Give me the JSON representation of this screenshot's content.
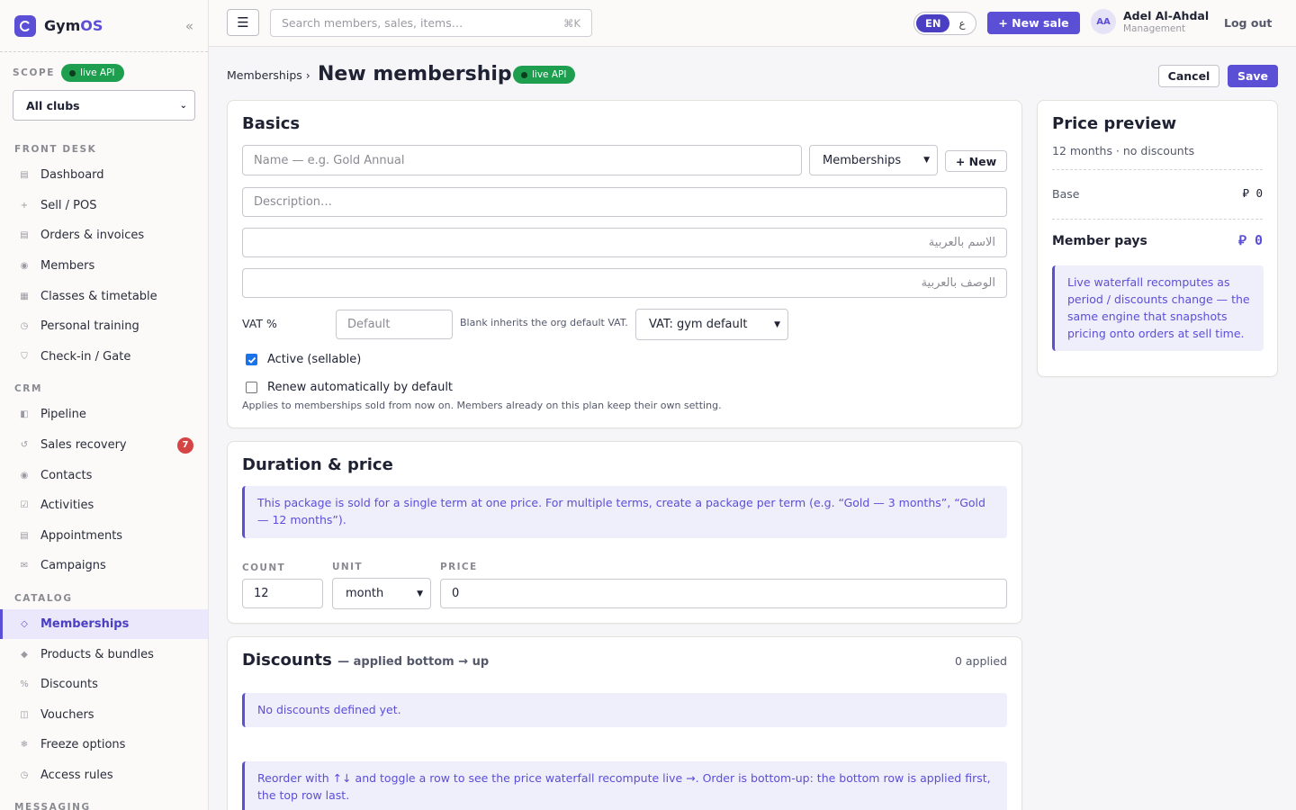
{
  "brand": {
    "name_prefix": "Gym",
    "name_suffix": "OS"
  },
  "sidebar": {
    "scope_label": "SCOPE",
    "live_label": "live API",
    "club_select": "All clubs",
    "groups": [
      {
        "label": "FRONT DESK",
        "items": [
          {
            "label": "Dashboard",
            "icon": "▤"
          },
          {
            "label": "Sell / POS",
            "icon": "+"
          },
          {
            "label": "Orders & invoices",
            "icon": "▤"
          },
          {
            "label": "Members",
            "icon": "◉"
          },
          {
            "label": "Classes & timetable",
            "icon": "▦"
          },
          {
            "label": "Personal training",
            "icon": "◷"
          },
          {
            "label": "Check-in / Gate",
            "icon": "⛉"
          }
        ]
      },
      {
        "label": "CRM",
        "items": [
          {
            "label": "Pipeline",
            "icon": "◧"
          },
          {
            "label": "Sales recovery",
            "icon": "↺",
            "badge": "7"
          },
          {
            "label": "Contacts",
            "icon": "◉"
          },
          {
            "label": "Activities",
            "icon": "☑"
          },
          {
            "label": "Appointments",
            "icon": "▤"
          },
          {
            "label": "Campaigns",
            "icon": "✉"
          }
        ]
      },
      {
        "label": "CATALOG",
        "items": [
          {
            "label": "Memberships",
            "icon": "◇",
            "active": true
          },
          {
            "label": "Products & bundles",
            "icon": "◆"
          },
          {
            "label": "Discounts",
            "icon": "%"
          },
          {
            "label": "Vouchers",
            "icon": "◫"
          },
          {
            "label": "Freeze options",
            "icon": "❄"
          },
          {
            "label": "Access rules",
            "icon": "◷"
          }
        ]
      },
      {
        "label": "MESSAGING",
        "items": []
      }
    ]
  },
  "topbar": {
    "menu_icon": "☰",
    "search_placeholder": "Search members, sales, items…",
    "search_shortcut": "⌘K",
    "lang_en": "EN",
    "lang_ar": "ع",
    "new_sale": "+ New sale",
    "user_initials": "AA",
    "user_name": "Adel Al-Ahdal",
    "user_role": "Management",
    "logout": "Log out"
  },
  "header": {
    "breadcrumb": "Memberships ›",
    "title": "New membership",
    "live_label": "live API",
    "cancel": "Cancel",
    "save": "Save"
  },
  "basics": {
    "title": "Basics",
    "name_placeholder": "Name — e.g. Gold Annual",
    "category": "Memberships",
    "new_btn": "+ New",
    "description_placeholder": "Description…",
    "name_ar_placeholder": "الاسم بالعربية",
    "description_ar_placeholder": "الوصف بالعربية",
    "vat_label": "VAT %",
    "vat_placeholder": "Default",
    "vat_hint": "Blank inherits the org default VAT.",
    "vat_select": "VAT: gym default",
    "active_label": "Active (sellable)",
    "active_checked": true,
    "renew_label": "Renew automatically by default",
    "renew_checked": false,
    "renew_hint": "Applies to memberships sold from now on. Members already on this plan keep their own setting."
  },
  "duration": {
    "title": "Duration & price",
    "info": "This package is sold for a single term at one price. For multiple terms, create a package per term (e.g. “Gold — 3 months”, “Gold — 12 months”).",
    "count_label": "COUNT",
    "count_value": "12",
    "unit_label": "UNIT",
    "unit_value": "month",
    "price_label": "PRICE",
    "price_value": "0"
  },
  "discounts": {
    "title": "Discounts",
    "subtitle": "— applied bottom → up",
    "applied": "0 applied",
    "empty": "No discounts defined yet.",
    "info": "Reorder with ↑↓ and toggle a row to see the price waterfall recompute live →. Order is bottom-up: the bottom row is applied first, the top row last."
  },
  "preview": {
    "title": "Price preview",
    "subtitle": "12 months · no discounts",
    "base_label": "Base",
    "currency": "⃁",
    "base_value": "0",
    "pays_label": "Member pays",
    "pays_value": "0",
    "info": "Live waterfall recomputes as period / discounts change — the same engine that snapshots pricing onto orders at sell time."
  },
  "colors": {
    "accent": "#5b4fd6",
    "live": "#1e9e4f",
    "badge": "#d64545"
  }
}
